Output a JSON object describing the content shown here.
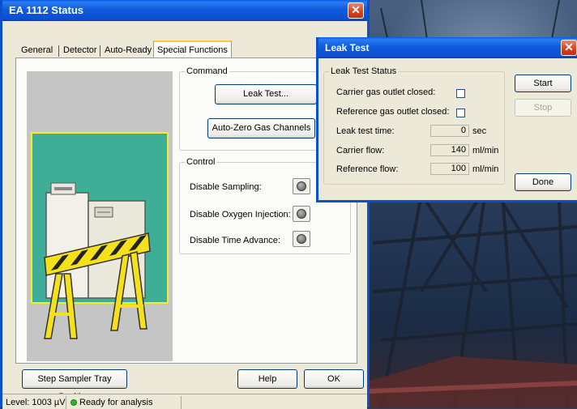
{
  "main_window": {
    "title": "EA 1112 Status",
    "close_glyph": "✕",
    "tabs": [
      "General",
      "Detector",
      "Auto-Ready",
      "Special Functions"
    ],
    "active_tab": 3,
    "command": {
      "label": "Command",
      "leak_test_button": "Leak Test...",
      "auto_zero_button": "Auto-Zero Gas Channels"
    },
    "control": {
      "label": "Control",
      "items": [
        {
          "label": "Disable Sampling:"
        },
        {
          "label": "Disable Oxygen Injection:"
        },
        {
          "label": "Disable Time Advance:"
        }
      ]
    },
    "footer": {
      "step_button": "Step Sampler Tray Position",
      "help_button": "Help",
      "ok_button": "OK"
    },
    "statusbar": {
      "level": "Level: 1003 µV",
      "status": "Ready for analysis",
      "status_color": "#2fb42f"
    },
    "illustration": {
      "icon": "instrument-under-construction",
      "panel_color": "#3fae96",
      "barrier_color": "#f5e11a"
    }
  },
  "leak_dialog": {
    "title": "Leak Test",
    "close_glyph": "✕",
    "group_label": "Leak Test Status",
    "carrier_outlet_label": "Carrier gas outlet closed:",
    "reference_outlet_label": "Reference gas outlet closed:",
    "leak_time": {
      "label": "Leak test time:",
      "value": "0",
      "unit": "sec"
    },
    "carrier_flow": {
      "label": "Carrier flow:",
      "value": "140",
      "unit": "ml/min"
    },
    "reference_flow": {
      "label": "Reference flow:",
      "value": "100",
      "unit": "ml/min"
    },
    "start_button": "Start",
    "stop_button": "Stop",
    "done_button": "Done"
  },
  "theme": {
    "titlebar_blue": "#0b4fcf",
    "window_face": "#ece9d8",
    "close_red": "#d4451f"
  }
}
